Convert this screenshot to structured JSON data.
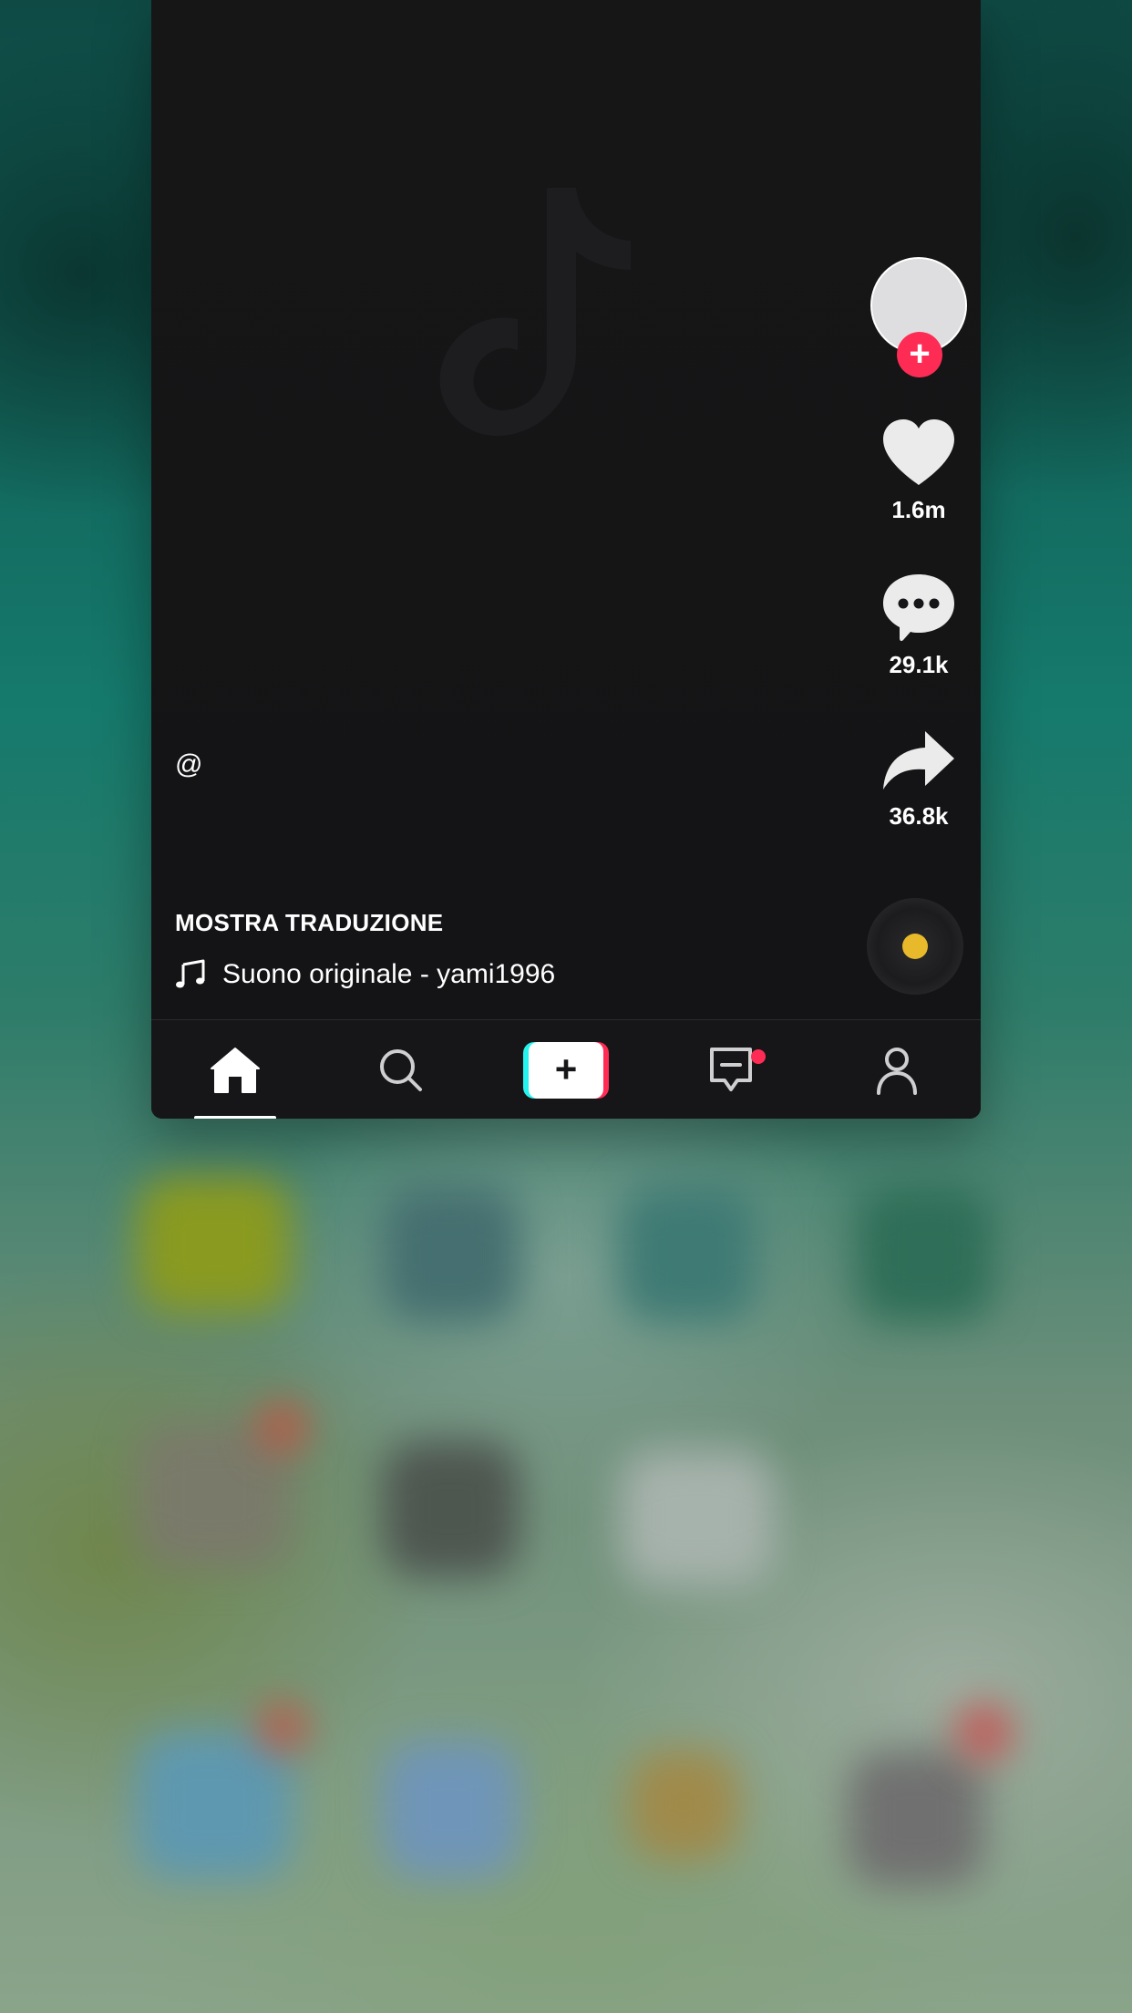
{
  "video": {
    "username_prefix": "@",
    "translate_label": "MOSTRA TRADUZIONE",
    "sound_label": "Suono originale - yami1996"
  },
  "actions": {
    "follow_symbol": "+",
    "likes": "1.6m",
    "comments": "29.1k",
    "shares": "36.8k"
  },
  "tabbar": {
    "create_symbol": "+",
    "tabs": [
      "home",
      "search",
      "create",
      "inbox",
      "profile"
    ],
    "active_tab": "home"
  },
  "colors": {
    "accent_red": "#fe2c55",
    "accent_cyan": "#25f4ee",
    "disc_center": "#e8b92a",
    "background": "#161618"
  }
}
